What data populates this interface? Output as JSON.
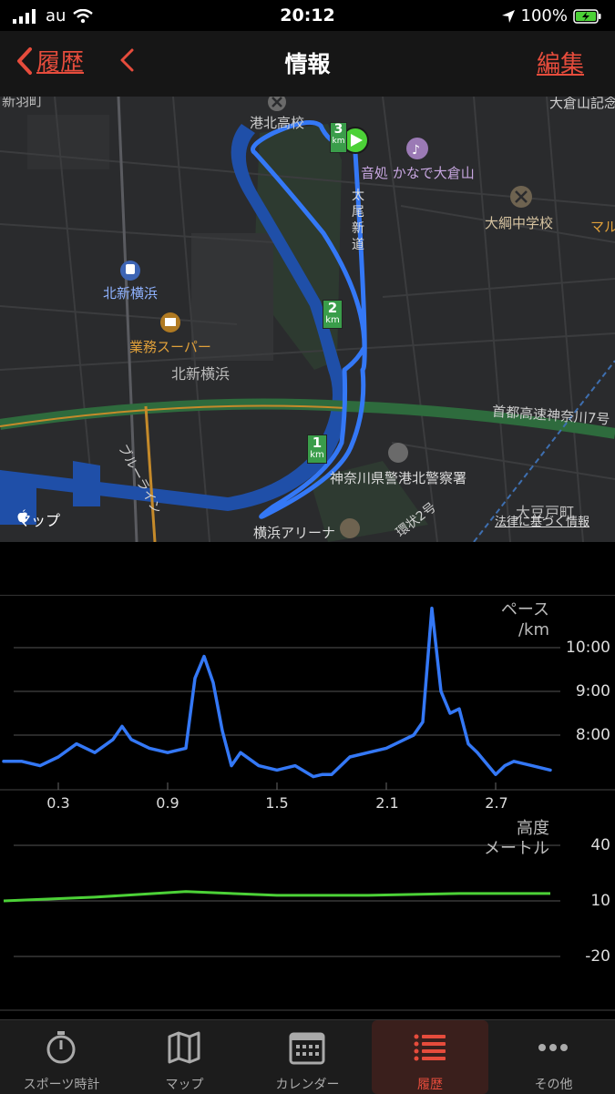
{
  "status": {
    "carrier": "au",
    "time": "20:12",
    "battery": "100%"
  },
  "nav": {
    "back_label": "履歴",
    "title": "情報",
    "edit_label": "編集"
  },
  "map": {
    "labels": {
      "kohoku_high": "港北高校",
      "onkasho": "音処 かなで大倉山",
      "oo_shindo": "太尾新道",
      "otsuna": "大綱中学校",
      "kitashin_station": "北新横浜",
      "gyomu": "業務スーパー",
      "kitashin_area": "北新横浜",
      "shuto": "首都高速神奈川7号",
      "police": "神奈川県警港北警察署",
      "arena": "横浜アリーナ",
      "blue_line": "ブルーライン",
      "kanjo": "環状2号",
      "odo": "大豆戸町",
      "okurayama_top": "大倉山記念",
      "maru": "マル",
      "top_left": "新羽町"
    },
    "km_markers": [
      "1",
      "2",
      "3"
    ],
    "km_unit": "km",
    "maps_label": "マップ",
    "legal": "法律に基づく情報"
  },
  "pace_chart": {
    "title_line1": "ペース",
    "title_line2": "/km",
    "y_ticks": [
      "10:00",
      "9:00",
      "8:00"
    ],
    "x_ticks": [
      "0.3",
      "0.9",
      "1.5",
      "2.1",
      "2.7"
    ]
  },
  "elev_chart": {
    "title_line1": "高度",
    "title_line2": "メートル",
    "y_ticks": [
      "40",
      "10",
      "-20"
    ]
  },
  "chart_data": [
    {
      "type": "line",
      "title": "ペース",
      "ylabel": "/km",
      "y_unit": "min:sec per km",
      "y_range_minutes": [
        7.0,
        11.2
      ],
      "y_ticks": [
        "8:00",
        "9:00",
        "10:00"
      ],
      "x_ticks": [
        0.3,
        0.9,
        1.5,
        2.1,
        2.7
      ],
      "x": [
        0.0,
        0.1,
        0.2,
        0.3,
        0.4,
        0.5,
        0.6,
        0.65,
        0.7,
        0.8,
        0.9,
        1.0,
        1.05,
        1.1,
        1.15,
        1.2,
        1.25,
        1.3,
        1.4,
        1.5,
        1.6,
        1.7,
        1.75,
        1.8,
        1.9,
        2.0,
        2.1,
        2.2,
        2.25,
        2.3,
        2.35,
        2.4,
        2.45,
        2.5,
        2.55,
        2.6,
        2.7,
        2.75,
        2.8,
        2.9,
        3.0
      ],
      "y": [
        7.4,
        7.4,
        7.3,
        7.5,
        7.8,
        7.6,
        7.9,
        8.2,
        7.9,
        7.7,
        7.6,
        7.7,
        9.3,
        9.8,
        9.2,
        8.1,
        7.3,
        7.6,
        7.3,
        7.2,
        7.3,
        7.05,
        7.1,
        7.1,
        7.5,
        7.6,
        7.7,
        7.9,
        8.0,
        8.3,
        10.9,
        9.0,
        8.5,
        8.6,
        7.8,
        7.6,
        7.1,
        7.3,
        7.4,
        7.3,
        7.2
      ],
      "color": "#3478f6"
    },
    {
      "type": "line",
      "title": "高度",
      "ylabel": "メートル",
      "y_range": [
        -35,
        52
      ],
      "y_ticks": [
        40,
        10,
        -20
      ],
      "x": [
        0.0,
        0.5,
        1.0,
        1.5,
        2.0,
        2.5,
        3.0
      ],
      "y": [
        10,
        12,
        15,
        13,
        13,
        14,
        14
      ],
      "color": "#4cd137"
    }
  ],
  "tabs": [
    {
      "label": "スポーツ時計"
    },
    {
      "label": "マップ"
    },
    {
      "label": "カレンダー"
    },
    {
      "label": "履歴"
    },
    {
      "label": "その他"
    }
  ]
}
